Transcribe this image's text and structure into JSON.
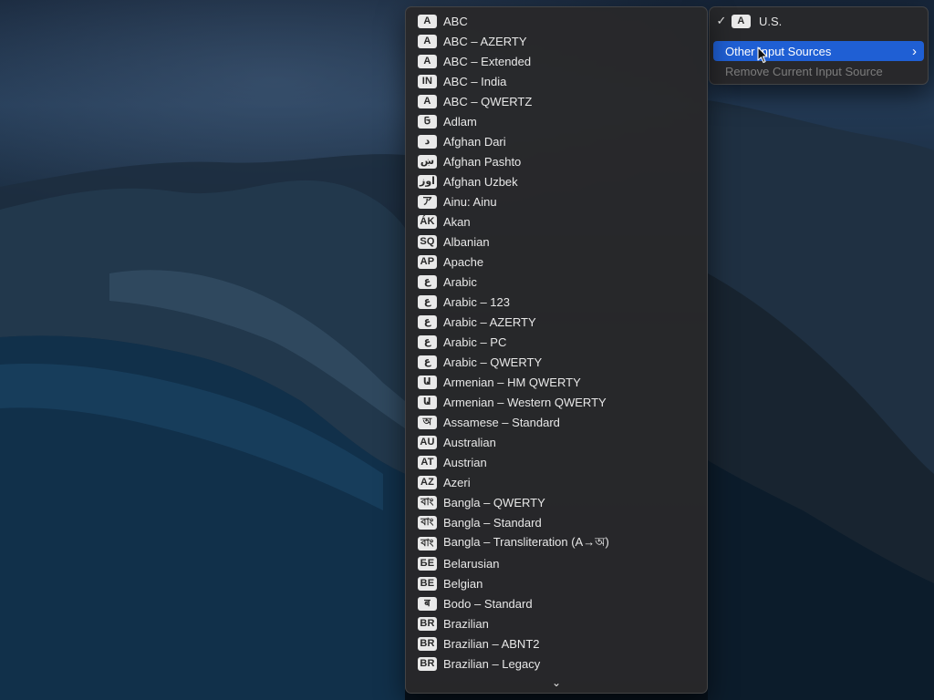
{
  "main_menu": {
    "current_source": {
      "check": "✓",
      "badge": "A",
      "label": "U.S."
    },
    "other_input_sources": {
      "label": "Other Input Sources",
      "chevron": "›"
    },
    "remove_current": {
      "label": "Remove Current Input Source"
    }
  },
  "submenu": {
    "items": [
      {
        "badge": "A",
        "label": "ABC"
      },
      {
        "badge": "A",
        "label": "ABC – AZERTY"
      },
      {
        "badge": "A",
        "label": "ABC – Extended"
      },
      {
        "badge": "IN",
        "label": "ABC – India"
      },
      {
        "badge": "A",
        "label": "ABC – QWERTZ"
      },
      {
        "badge": "𞤀",
        "label": "Adlam"
      },
      {
        "badge": "د",
        "label": "Afghan Dari"
      },
      {
        "badge": "ښ",
        "label": "Afghan Pashto"
      },
      {
        "badge": "اوز",
        "label": "Afghan Uzbek"
      },
      {
        "badge": "ア",
        "label": "Ainu: Ainu"
      },
      {
        "badge": "ÁK",
        "label": "Akan"
      },
      {
        "badge": "SQ",
        "label": "Albanian"
      },
      {
        "badge": "AP",
        "label": "Apache"
      },
      {
        "badge": "ع",
        "label": "Arabic"
      },
      {
        "badge": "ع",
        "label": "Arabic – 123"
      },
      {
        "badge": "ع",
        "label": "Arabic – AZERTY"
      },
      {
        "badge": "ع",
        "label": "Arabic – PC"
      },
      {
        "badge": "ع",
        "label": "Arabic – QWERTY"
      },
      {
        "badge": "Ա",
        "label": "Armenian – HM QWERTY"
      },
      {
        "badge": "Ա",
        "label": "Armenian – Western QWERTY"
      },
      {
        "badge": "অ",
        "label": "Assamese – Standard"
      },
      {
        "badge": "AU",
        "label": "Australian"
      },
      {
        "badge": "AT",
        "label": "Austrian"
      },
      {
        "badge": "AZ",
        "label": "Azeri"
      },
      {
        "badge": "বাং",
        "label": "Bangla – QWERTY"
      },
      {
        "badge": "বাং",
        "label": "Bangla – Standard"
      },
      {
        "badge": "বাং",
        "label": "Bangla – Transliteration (A→অ)"
      },
      {
        "badge": "БЕ",
        "label": "Belarusian"
      },
      {
        "badge": "BE",
        "label": "Belgian"
      },
      {
        "badge": "ब",
        "label": "Bodo – Standard"
      },
      {
        "badge": "BR",
        "label": "Brazilian"
      },
      {
        "badge": "BR",
        "label": "Brazilian – ABNT2"
      },
      {
        "badge": "BR",
        "label": "Brazilian – Legacy"
      }
    ],
    "scroll_down": "⌄"
  },
  "colors": {
    "menu_bg": "#28282a",
    "highlight": "#1f5fd4",
    "badge_bg": "#e9e9e9",
    "disabled_text": "#7c7c7c"
  },
  "icons": {
    "check": "checkmark-icon",
    "chevron": "chevron-right-icon",
    "scroll": "chevron-down-icon",
    "cursor": "mouse-pointer-icon"
  }
}
